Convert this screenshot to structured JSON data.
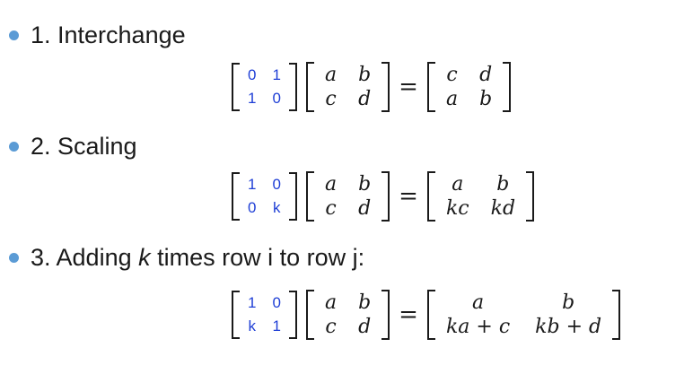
{
  "bullets": {
    "interchange": "1. Interchange",
    "scaling": "2. Scaling",
    "adding_prefix": "3. Adding ",
    "adding_k": "k",
    "adding_suffix": " times row i to row j:"
  },
  "equations": {
    "interchange": {
      "op": [
        "0",
        "1",
        "1",
        "0"
      ],
      "m": [
        "a",
        "b",
        "c",
        "d"
      ],
      "equals": "=",
      "result": [
        "c",
        "d",
        "a",
        "b"
      ]
    },
    "scaling": {
      "op": [
        "1",
        "0",
        "0",
        "k"
      ],
      "m": [
        "a",
        "b",
        "c",
        "d"
      ],
      "equals": "=",
      "result": [
        "a",
        "b",
        "kc",
        "kd"
      ]
    },
    "adding": {
      "op": [
        "1",
        "0",
        "k",
        "1"
      ],
      "m": [
        "a",
        "b",
        "c",
        "d"
      ],
      "equals": "=",
      "result": [
        "a",
        "b",
        "ka + c",
        "kb + d"
      ]
    }
  },
  "colors": {
    "bullet": "#5b9bd5",
    "operator_entries": "#1f3fd6",
    "text": "#1a1a1a"
  }
}
